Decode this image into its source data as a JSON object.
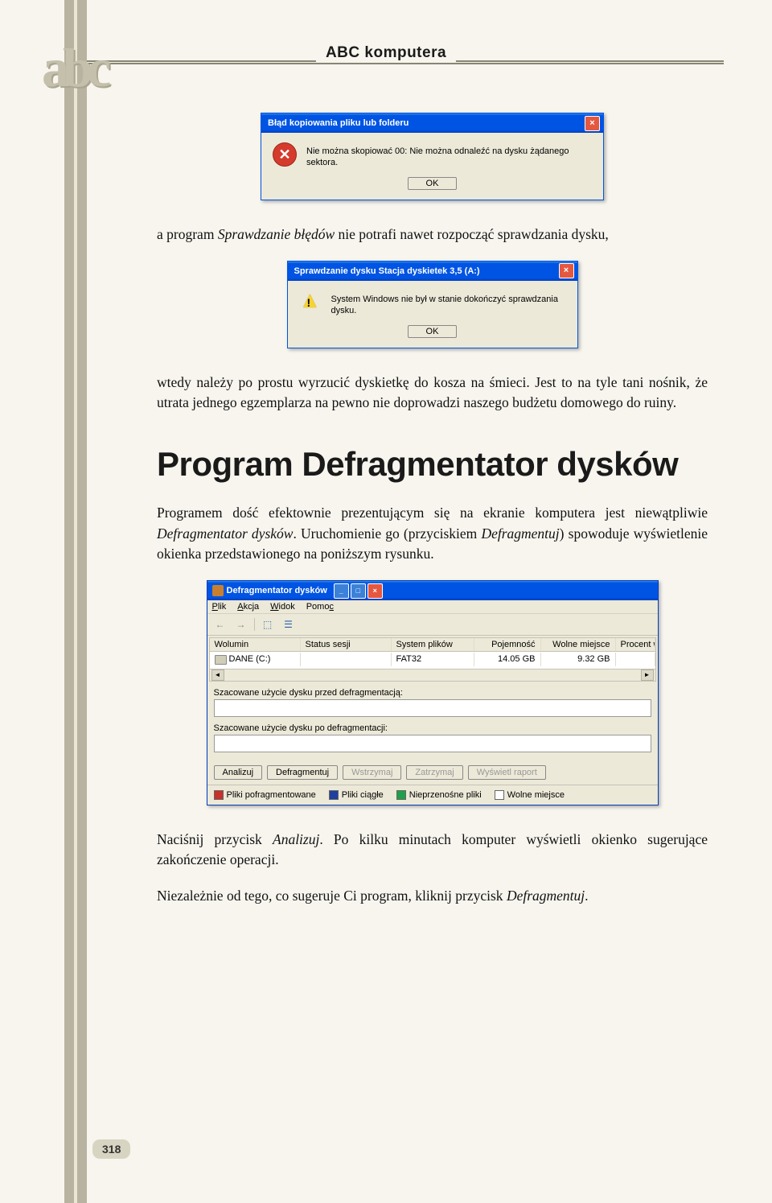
{
  "header_title": "ABC komputera",
  "logo_text": "abc",
  "dialog1": {
    "title": "Błąd kopiowania pliku lub folderu",
    "message": "Nie można skopiować 00: Nie można odnaleźć na dysku żądanego sektora.",
    "ok": "OK"
  },
  "para1_pre": "a program ",
  "para1_em": "Sprawdzanie błędów",
  "para1_post": " nie potrafi nawet rozpocząć sprawdzania dysku,",
  "dialog2": {
    "title": "Sprawdzanie dysku Stacja dyskietek 3,5 (A:)",
    "message": "System Windows nie był w stanie dokończyć sprawdzania dysku.",
    "ok": "OK"
  },
  "para2": "wtedy należy po prostu wyrzucić dyskietkę do kosza na śmieci. Jest to na tyle tani nośnik, że utrata jednego egzemplarza na pewno nie doprowadzi naszego budżetu domowego do ruiny.",
  "section_heading": "Program Defragmentator dysków",
  "para3_a": "Programem dość efektownie prezentującym się na ekranie komputera jest niewątpliwie ",
  "para3_em1": "Defragmentator dysków",
  "para3_b": ". Uruchomienie go (przyciskiem ",
  "para3_em2": "Defragmentuj",
  "para3_c": ") spowoduje wyświetlenie okienka przedstawionego na poniższym rysunku.",
  "defrag": {
    "title": "Defragmentator dysków",
    "menu": {
      "file": "Plik",
      "action": "Akcja",
      "view": "Widok",
      "help": "Pomoc"
    },
    "cols": {
      "vol": "Wolumin",
      "stat": "Status sesji",
      "fs": "System plików",
      "cap": "Pojemność",
      "free": "Wolne miejsce",
      "pct": "Procent wolne"
    },
    "row": {
      "vol": "DANE (C:)",
      "stat": "",
      "fs": "FAT32",
      "cap": "14.05 GB",
      "free": "9.32 GB"
    },
    "est_before": "Szacowane użycie dysku przed defragmentacją:",
    "est_after": "Szacowane użycie dysku po defragmentacji:",
    "buttons": {
      "analyze": "Analizuj",
      "defrag": "Defragmentuj",
      "pause": "Wstrzymaj",
      "stop": "Zatrzymaj",
      "report": "Wyświetl raport"
    },
    "legend": {
      "frag": "Pliki pofragmentowane",
      "contig": "Pliki ciągłe",
      "unmov": "Nieprzenośne pliki",
      "free": "Wolne miejsce"
    },
    "colors": {
      "frag": "#c83228",
      "contig": "#2040a0",
      "unmov": "#20a048",
      "free": "#ffffff"
    }
  },
  "para4_a": "Naciśnij przycisk ",
  "para4_em1": "Analizuj",
  "para4_b": ". Po kilku minutach komputer wyświetli okienko sugerujące zakończenie operacji.",
  "para5_a": "Niezależnie od tego, co sugeruje Ci program, kliknij przycisk ",
  "para5_em1": "Defragmentuj",
  "para5_b": ".",
  "page_number": "318"
}
